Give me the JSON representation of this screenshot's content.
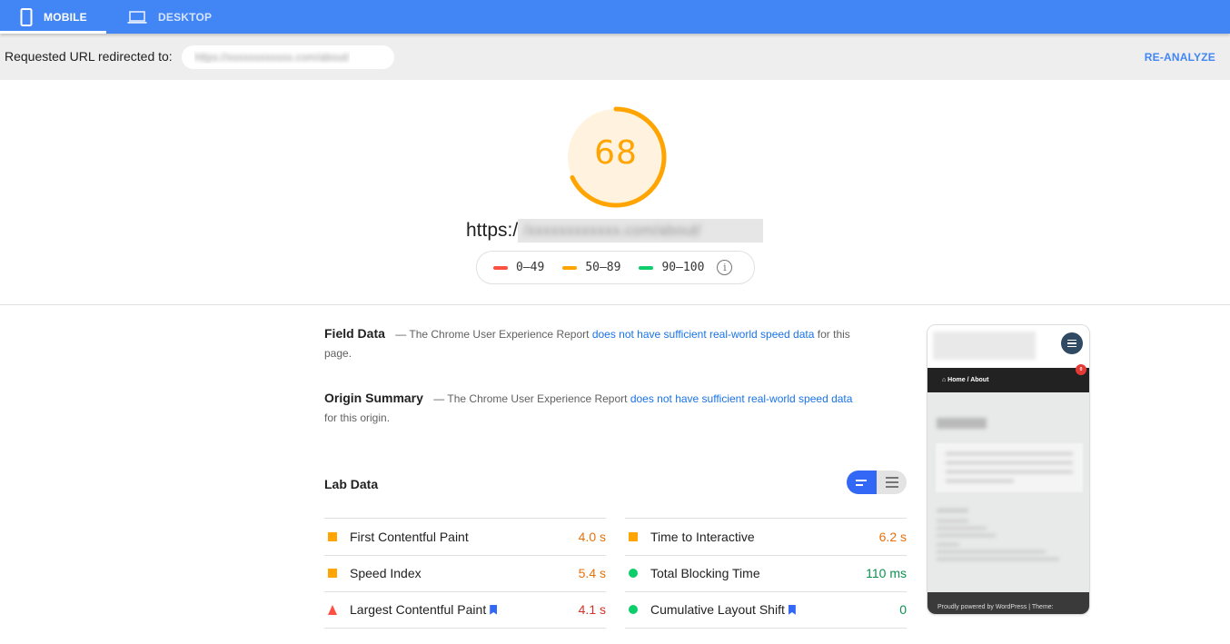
{
  "tabs": [
    {
      "label": "MOBILE",
      "icon": "smartphone-icon",
      "active": true
    },
    {
      "label": "DESKTOP",
      "icon": "laptop-icon",
      "active": false
    }
  ],
  "redirect": {
    "label": "Requested URL redirected to:",
    "url_blurred": "https://xxxxxxxxxxxx.com/about/",
    "reanalyze_label": "RE-ANALYZE"
  },
  "score": {
    "value": 68,
    "display": "68",
    "color": "#ffa400",
    "track_color": "#fff3e0"
  },
  "page_url": {
    "prefix": "https:/",
    "blurred": "/xxxxxxxxxxxx.com/about/"
  },
  "legend": [
    {
      "range": "0–49",
      "color": "#ff4e42"
    },
    {
      "range": "50–89",
      "color": "#ffa400"
    },
    {
      "range": "90–100",
      "color": "#0cce6b"
    }
  ],
  "legend_info_icon": "i",
  "field_data": {
    "title": "Field Data",
    "dash": "—",
    "text_before": "The Chrome User Experience Report",
    "link": "does not have sufficient real-world speed data",
    "text_after": "for this page."
  },
  "origin_summary": {
    "title": "Origin Summary",
    "dash": "—",
    "text_before": "The Chrome User Experience Report",
    "link": "does not have sufficient real-world speed data",
    "text_after": "for this origin."
  },
  "lab_data": {
    "title": "Lab Data",
    "view_toggle": {
      "selected": "compact"
    },
    "metrics_left": [
      {
        "name": "First Contentful Paint",
        "value": "4.0 s",
        "status": "average",
        "icon": "square",
        "bookmark": false
      },
      {
        "name": "Speed Index",
        "value": "5.4 s",
        "status": "average",
        "icon": "square",
        "bookmark": false
      },
      {
        "name": "Largest Contentful Paint",
        "value": "4.1 s",
        "status": "fail",
        "icon": "triangle",
        "bookmark": true
      }
    ],
    "metrics_right": [
      {
        "name": "Time to Interactive",
        "value": "6.2 s",
        "status": "average",
        "icon": "square",
        "bookmark": false
      },
      {
        "name": "Total Blocking Time",
        "value": "110 ms",
        "status": "pass",
        "icon": "circle",
        "bookmark": false
      },
      {
        "name": "Cumulative Layout Shift",
        "value": "0",
        "status": "pass",
        "icon": "circle",
        "bookmark": true
      }
    ]
  },
  "thumbnail": {
    "breadcrumb": "⌂ Home / About",
    "cart_badge": "0",
    "footer": "Proudly powered by WordPress | Theme:"
  }
}
